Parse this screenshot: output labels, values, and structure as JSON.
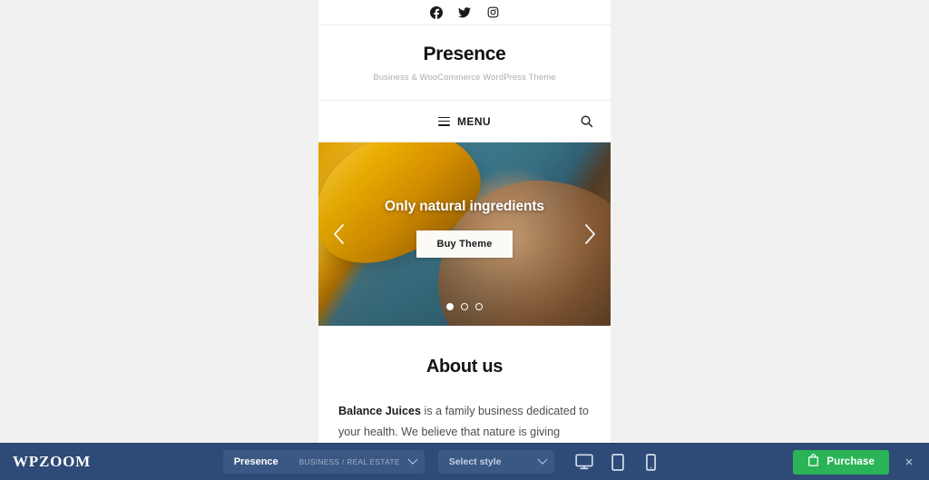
{
  "colors": {
    "page_background": "#f1f1f1",
    "toolbar_background": "#2e4a76",
    "toolbar_field": "#3b5783",
    "purchase_green": "#2bb457",
    "slider_teal": "#3b7d92",
    "juice_orange": "#f0b71b"
  },
  "preview": {
    "social": [
      {
        "name": "facebook-icon",
        "label": "Facebook"
      },
      {
        "name": "twitter-icon",
        "label": "Twitter"
      },
      {
        "name": "instagram-icon",
        "label": "Instagram"
      }
    ],
    "branding": {
      "site_title": "Presence",
      "tagline": "Business & WooCommerce WordPress Theme"
    },
    "nav": {
      "menu_label": "MENU",
      "menu_icon": "hamburger-icon",
      "search_icon": "search-icon"
    },
    "slider": {
      "slide_title": "Only natural ingredients",
      "cta_label": "Buy Theme",
      "prev_icon": "chevron-left-icon",
      "next_icon": "chevron-right-icon",
      "dots": [
        {
          "active": true
        },
        {
          "active": false
        },
        {
          "active": false
        }
      ],
      "active_slide": 1,
      "total_slides": 3
    },
    "about": {
      "heading": "About us",
      "lead_bold": "Balance Juices",
      "body_rest": " is a family business dedicated to your health. We believe that nature is giving"
    }
  },
  "toolbar": {
    "logo": "WPZOOM",
    "theme_select": {
      "name": "Presence",
      "category": "BUSINESS / REAL ESTATE",
      "caret_icon": "chevron-down-icon"
    },
    "style_select": {
      "label": "Select style",
      "caret_icon": "chevron-down-icon"
    },
    "devices": [
      {
        "name": "desktop-icon",
        "label": "Desktop"
      },
      {
        "name": "tablet-icon",
        "label": "Tablet"
      },
      {
        "name": "mobile-icon",
        "label": "Mobile"
      }
    ],
    "purchase": {
      "label": "Purchase",
      "icon": "shopping-bag-icon"
    },
    "close": {
      "label": "×",
      "icon": "close-icon"
    }
  }
}
